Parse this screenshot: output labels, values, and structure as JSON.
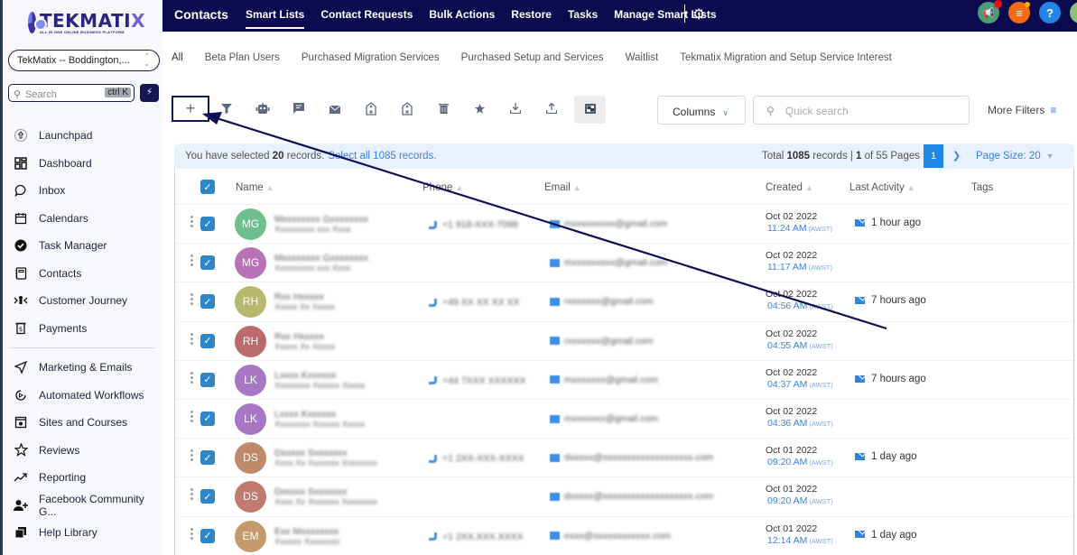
{
  "sidebar": {
    "logo": {
      "word": "TEKMATI",
      "word_accent": "X",
      "tagline": "ALL IN ONE ONLINE BUSINESS PLATFORM"
    },
    "location": "TekMatix -- Boddington,...",
    "search": {
      "placeholder": "Search",
      "shortcut": "ctrl K"
    },
    "items_primary": [
      {
        "label": "Launchpad",
        "icon": "rocket-icon"
      },
      {
        "label": "Dashboard",
        "icon": "dashboard-icon"
      },
      {
        "label": "Inbox",
        "icon": "chat-icon"
      },
      {
        "label": "Calendars",
        "icon": "calendar-icon"
      },
      {
        "label": "Task Manager",
        "icon": "check-circle-icon"
      },
      {
        "label": "Contacts",
        "icon": "contact-book-icon"
      },
      {
        "label": "Customer Journey",
        "icon": "journey-icon"
      },
      {
        "label": "Payments",
        "icon": "payments-icon"
      }
    ],
    "items_secondary": [
      {
        "label": "Marketing & Emails",
        "icon": "send-icon"
      },
      {
        "label": "Automated Workflows",
        "icon": "workflow-icon"
      },
      {
        "label": "Sites and Courses",
        "icon": "sites-icon"
      },
      {
        "label": "Reviews",
        "icon": "star-outline-icon"
      },
      {
        "label": "Reporting",
        "icon": "trend-icon"
      },
      {
        "label": "Facebook Community G...",
        "icon": "add-user-icon"
      },
      {
        "label": "Help Library",
        "icon": "library-icon"
      }
    ]
  },
  "topbar": {
    "title": "Contacts",
    "tabs": [
      {
        "label": "Smart Lists",
        "active": true
      },
      {
        "label": "Contact Requests"
      },
      {
        "label": "Bulk Actions"
      },
      {
        "label": "Restore"
      },
      {
        "label": "Tasks"
      },
      {
        "label": "Manage Smart Lists"
      }
    ],
    "colors": {
      "bar": "#0c0b4f",
      "announce": "#4c9a76",
      "tasks": "#f56a12",
      "help": "#2384e8",
      "avatar": "#8bc07a"
    }
  },
  "smart_lists": [
    {
      "label": "All",
      "active": true
    },
    {
      "label": "Beta Plan Users"
    },
    {
      "label": "Purchased Migration Services"
    },
    {
      "label": "Purchased Setup and Services"
    },
    {
      "label": "Waitlist"
    },
    {
      "label": "Tekmatix Migration and Setup Service Interest"
    }
  ],
  "toolbar": {
    "add": "+",
    "columns_label": "Columns",
    "quick_search_placeholder": "Quick search",
    "more_filters_label": "More Filters"
  },
  "banner": {
    "selected_prefix": "You have selected ",
    "selected_count": "20",
    "selected_suffix": " records.",
    "select_all_link": "Select all 1085 records.",
    "total_prefix": "Total ",
    "total_count": "1085",
    "total_mid": " records | ",
    "page_current": "1",
    "page_of": " of 55 Pages",
    "page_button": "1",
    "page_size": "Page Size: 20"
  },
  "table": {
    "headers": {
      "name": "Name",
      "phone": "Phone",
      "email": "Email",
      "created": "Created",
      "last_activity": "Last Activity",
      "tags": "Tags"
    },
    "rows": [
      {
        "initials": "MG",
        "color": "#6fbf8e",
        "name": "Mxxxxxxxx Gxxxxxxxx",
        "sub": "Xxxxxxxxx xxx Xxxx",
        "phone": "+1 918-XXX-7099",
        "email": "mxxxxxxxxx@gmail.com",
        "date": "Oct 02 2022",
        "time": "11:24 AM",
        "tz": "(AWST)",
        "activity": "1 hour ago"
      },
      {
        "initials": "MG",
        "color": "#b872b8",
        "name": "Mxxxxxxxx Gxxxxxxxx",
        "sub": "Xxxxxxxxx xxx Xxxx",
        "phone": "",
        "email": "mxxxxxxxxx@gmail.com",
        "date": "Oct 02 2022",
        "time": "11:17 AM",
        "tz": "(AWST)",
        "activity": ""
      },
      {
        "initials": "RH",
        "color": "#b7b86e",
        "name": "Rxx Hxxxxx",
        "sub": "Xxxxx Xx Xxxxx",
        "phone": "+49 XX XX XX XX",
        "email": "rxxxxxxx@gmail.com",
        "date": "Oct 02 2022",
        "time": "04:56 AM",
        "tz": "(AWST)",
        "activity": "7 hours ago"
      },
      {
        "initials": "RH",
        "color": "#bb6b6b",
        "name": "Rxx Hxxxxx",
        "sub": "Xxxxx Xx Xxxxx",
        "phone": "",
        "email": "rxxxxxxx@gmail.com",
        "date": "Oct 02 2022",
        "time": "04:55 AM",
        "tz": "(AWST)",
        "activity": ""
      },
      {
        "initials": "LK",
        "color": "#a877c4",
        "name": "Lxxxx Kxxxxxx",
        "sub": "Xxxxxxxx Xxxxxx Xxxxx",
        "phone": "+44 7XXX XXXXXX",
        "email": "mxxxxxxx@gmail.com",
        "date": "Oct 02 2022",
        "time": "04:37 AM",
        "tz": "(AWST)",
        "activity": "7 hours ago"
      },
      {
        "initials": "LK",
        "color": "#a877c4",
        "name": "Lxxxx Kxxxxxx",
        "sub": "Xxxxxxxx Xxxxxx Xxxxx",
        "phone": "",
        "email": "mxxxxxxx@gmail.com",
        "date": "Oct 02 2022",
        "time": "04:36 AM",
        "tz": "(AWST)",
        "activity": ""
      },
      {
        "initials": "DS",
        "color": "#c08a6a",
        "name": "Dxxxxx Sxxxxxxx",
        "sub": "Xxxx Xx Xxxxxxx Xxxxxxxx",
        "phone": "+1 2XX-XXX-XXXX",
        "email": "dxxxxx@xxxxxxxxxxxxxxxxxxx.com",
        "date": "Oct 01 2022",
        "time": "09:20 AM",
        "tz": "(AWST)",
        "activity": "1 day ago"
      },
      {
        "initials": "DS",
        "color": "#c07a6e",
        "name": "Dxxxxx Sxxxxxxx",
        "sub": "Xxxx Xx Xxxxxxx Xxxxxxxx",
        "phone": "",
        "email": "dxxxxx@xxxxxxxxxxxxxxxxxxx.com",
        "date": "Oct 01 2022",
        "time": "09:20 AM",
        "tz": "(AWST)",
        "activity": ""
      },
      {
        "initials": "EM",
        "color": "#c49a6c",
        "name": "Exx Mxxxxxxxx",
        "sub": "Xxxxxx Xxxxxxxx",
        "phone": "+1 2XX.XXX.XXXX",
        "email": "exxx@xxxxxxxxxxxx.com",
        "date": "Oct 01 2022",
        "time": "12:14 AM",
        "tz": "(AWST)",
        "activity": "1 day ago"
      }
    ]
  }
}
